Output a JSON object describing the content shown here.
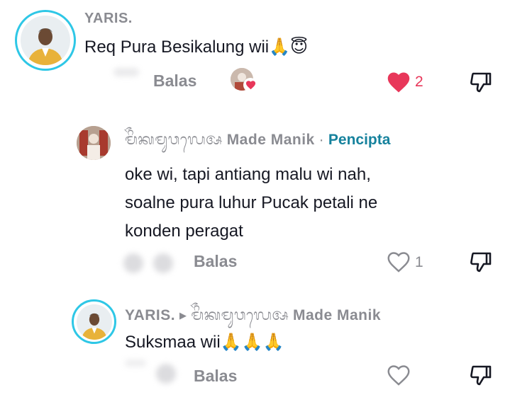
{
  "comments": [
    {
      "username": "YARIS.",
      "text": "Req Pura Besikalung wii🙏😇",
      "reply_label": "Balas",
      "like_count": "2",
      "liked": true
    },
    {
      "username_script": "ᬫᬶᭂᬓᬫᬸᬯᬮᬾᬅ",
      "username": "Made Manik",
      "separator": "·",
      "creator_badge": "Pencipta",
      "text_lines": [
        "oke wi, tapi antiang malu wi nah,",
        "soalne pura luhur Pucak petali ne",
        "konden peragat"
      ],
      "reply_label": "Balas",
      "like_count": "1",
      "liked": false
    },
    {
      "username": "YARIS.",
      "reply_arrow": "▶",
      "reply_to_script": "ᬫᬶᭂᬓᬫᬸᬯᬮᬾᬅ",
      "reply_to": "Made Manik",
      "text": "Suksmaa wii🙏🙏🙏",
      "reply_label": "Balas",
      "like_count": "",
      "liked": false
    }
  ],
  "icons": {
    "heart_filled": "heart-filled-icon",
    "heart_outline": "heart-outline-icon",
    "dislike": "thumbs-down-icon"
  },
  "colors": {
    "accent_ring": "#2ec7e6",
    "creator": "#16829d",
    "like_red": "#e8375a",
    "muted": "#8a8b91"
  }
}
